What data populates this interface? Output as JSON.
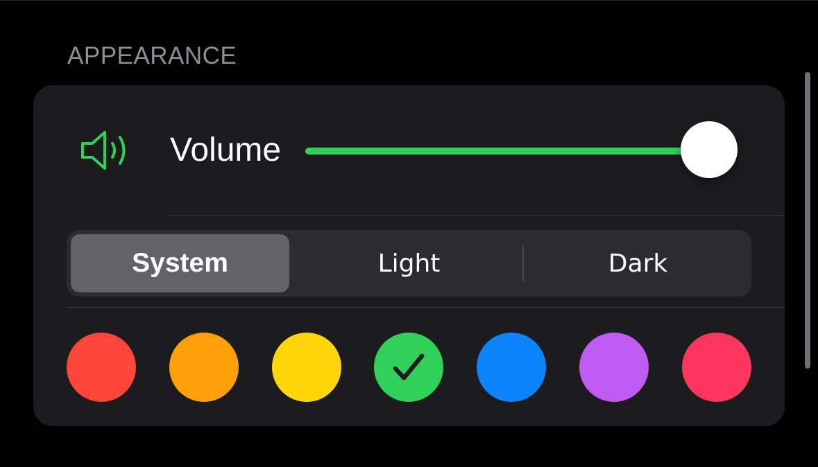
{
  "section": {
    "title": "APPEARANCE"
  },
  "volume": {
    "label": "Volume",
    "icon": "speaker-wave-icon",
    "level": 0.97,
    "accent_color": "#30d158"
  },
  "appearance_mode": {
    "options": [
      "System",
      "Light",
      "Dark"
    ],
    "selected": "System"
  },
  "accent_colors": {
    "options": [
      {
        "name": "red",
        "color": "#ff453a"
      },
      {
        "name": "orange",
        "color": "#ff9f0a"
      },
      {
        "name": "yellow",
        "color": "#ffd60a"
      },
      {
        "name": "green",
        "color": "#30d158"
      },
      {
        "name": "blue",
        "color": "#0a84ff"
      },
      {
        "name": "purple",
        "color": "#bf5af2"
      },
      {
        "name": "pink",
        "color": "#ff375f"
      }
    ],
    "selected": "green",
    "checkmark_icon": "checkmark-icon"
  }
}
